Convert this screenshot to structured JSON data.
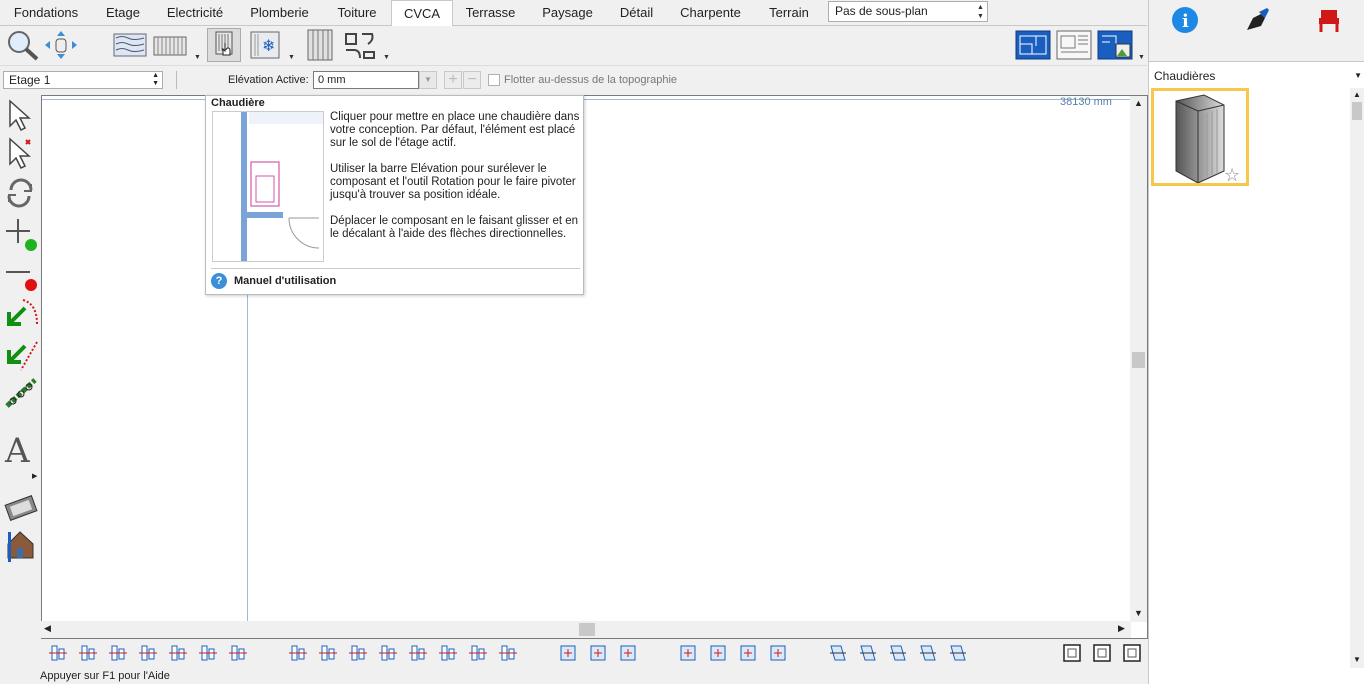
{
  "menu": {
    "tabs": [
      {
        "label": "Fondations",
        "active": false
      },
      {
        "label": "Etage",
        "active": false
      },
      {
        "label": "Electricité",
        "active": false
      },
      {
        "label": "Plomberie",
        "active": false
      },
      {
        "label": "Toiture",
        "active": false
      },
      {
        "label": "CVCA",
        "active": true
      },
      {
        "label": "Terrasse",
        "active": false
      },
      {
        "label": "Paysage",
        "active": false
      },
      {
        "label": "Détail",
        "active": false
      },
      {
        "label": "Charpente",
        "active": false
      },
      {
        "label": "Terrain",
        "active": false
      }
    ],
    "subplan_select": "Pas de sous-plan"
  },
  "row2": {
    "floor_select": "Etage 1",
    "elevation_label": "Elévation Active:",
    "elevation_value": "0 mm",
    "float_label": "Flotter au-dessus de la topographie",
    "float_checked": false
  },
  "canvas": {
    "dimension_label": "38130 mm"
  },
  "tooltip": {
    "title": "Chaudière",
    "p1": "Cliquer pour mettre en place une chaudière dans votre conception. Par défaut, l'élément est placé sur le sol de l'étage actif.",
    "p2": "Utiliser la barre Elévation pour surélever le composant et l'outil Rotation pour le faire pivoter jusqu'à trouver sa position idéale.",
    "p3": "Déplacer le composant en le faisant glisser et en le décalant à l'aide des flèches directionnelles.",
    "manual_link": "Manuel d'utilisation"
  },
  "right_panel": {
    "category": "Chaudières",
    "accent": "#f6c94a"
  },
  "status_bar": "Appuyer sur F1 pour l'Aide",
  "colors": {
    "accent_blue": "#1a5fbf",
    "info_blue": "#1e88e5",
    "red_icon": "#d01818"
  }
}
